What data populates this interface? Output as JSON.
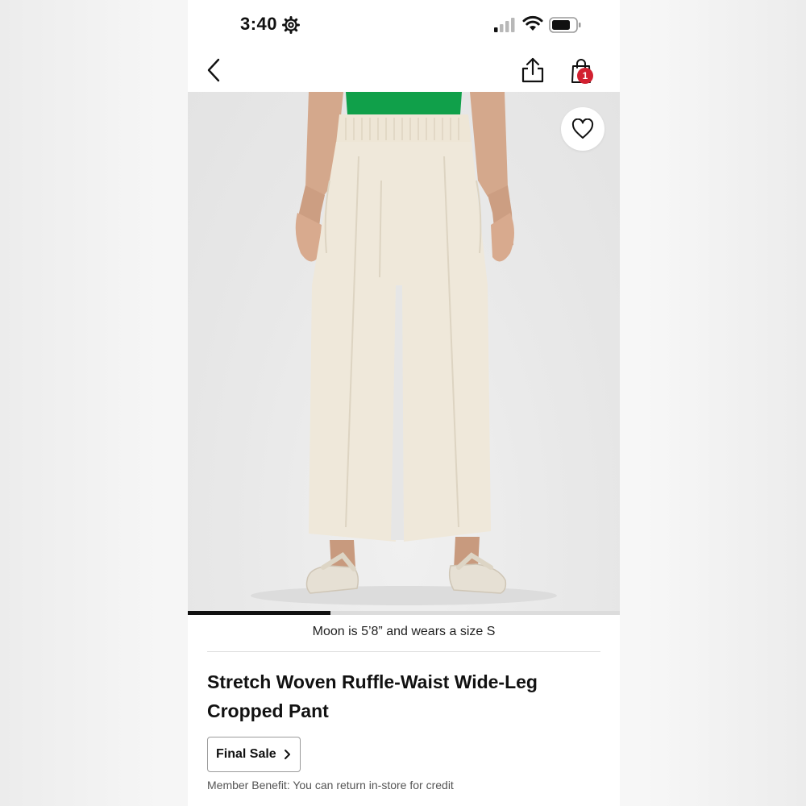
{
  "status_bar": {
    "time": "3:40",
    "icons": [
      "gear-icon",
      "signal-icon",
      "wifi-icon",
      "battery-icon"
    ]
  },
  "nav": {
    "icons": [
      "chevron-left-icon",
      "share-icon",
      "shopping-bag-icon"
    ],
    "bag_count": "1"
  },
  "product": {
    "image_alt_icon": "heart-icon",
    "gallery_progress": 0.33,
    "model_info": "Moon is 5’8” and wears a size S",
    "title": "Stretch Woven Ruffle-Waist Wide-Leg Cropped Pant",
    "final_sale_label": "Final Sale",
    "member_benefit": "Member Benefit: You can return in-store for credit"
  },
  "colors": {
    "badge": "#d22030",
    "top_garment": "#10a04a",
    "pant": "#efe8da",
    "background": "#e9e9e9"
  }
}
